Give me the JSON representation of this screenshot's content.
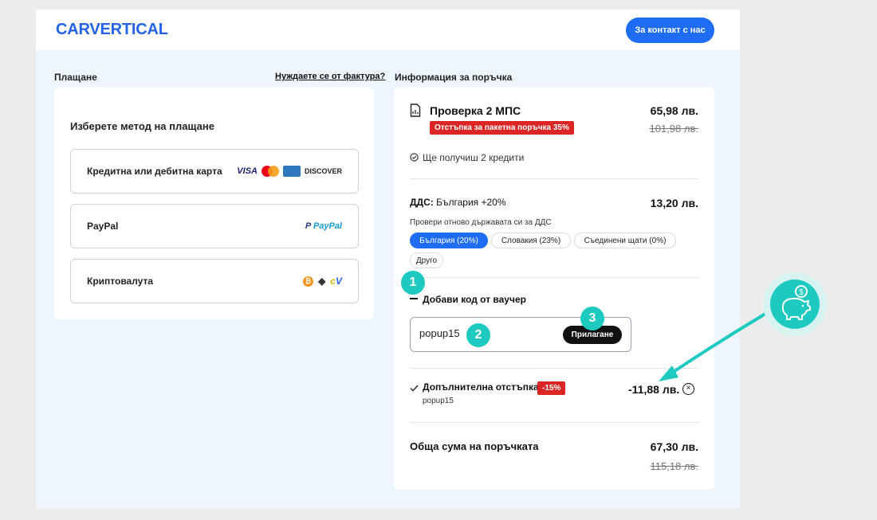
{
  "header": {
    "logo": "CARVERTICAL",
    "contact_label": "За контакт с нас"
  },
  "payment": {
    "section_title": "Плащане",
    "invoice_link": "Нуждаете се от фактура?",
    "heading": "Изберете метод на плащане",
    "options": [
      {
        "label": "Кредитна или дебитна карта",
        "logos": [
          "VISA",
          "mastercard",
          "amex",
          "DISCOVER"
        ]
      },
      {
        "label": "PayPal",
        "logos": [
          "PayPal"
        ]
      },
      {
        "label": "Криптовалута",
        "logos": [
          "bitcoin",
          "ethereum",
          "cv"
        ]
      }
    ]
  },
  "order": {
    "section_title": "Информация за поръчка",
    "product": {
      "title": "Проверка 2 МПС",
      "discount_badge": "Отстъпка за пакетна поръчка 35%",
      "price": "65,98 лв.",
      "old_price": "101,98 лв.",
      "credits_text": "Ще получиш 2 кредити"
    },
    "vat": {
      "label": "ДДС:",
      "country_rate": "България +20%",
      "amount": "13,20 лв.",
      "recheck_text": "Провери отново държавата си за ДДС",
      "options": [
        "България (20%)",
        "Словакия (23%)",
        "Съединени щати (0%)",
        "Друго"
      ],
      "selected": "България (20%)"
    },
    "voucher": {
      "toggle_label": "Добави код от ваучер",
      "input_value": "popup15",
      "apply_label": "Прилагане"
    },
    "extra_discount": {
      "label": "Допълнителна отстъпка",
      "badge": "-15%",
      "code": "popup15",
      "amount": "-11,88 лв."
    },
    "total": {
      "label": "Обща сума на поръчката",
      "amount": "67,30 лв.",
      "old_amount": "115,18 лв."
    }
  },
  "annotations": {
    "steps": [
      "1",
      "2",
      "3"
    ],
    "accent_color": "#1ec9c0",
    "icon": "piggy-bank-coin-icon"
  },
  "colors": {
    "brand": "#2563eb",
    "button": "#1f6cf5",
    "badge": "#dc2626"
  }
}
